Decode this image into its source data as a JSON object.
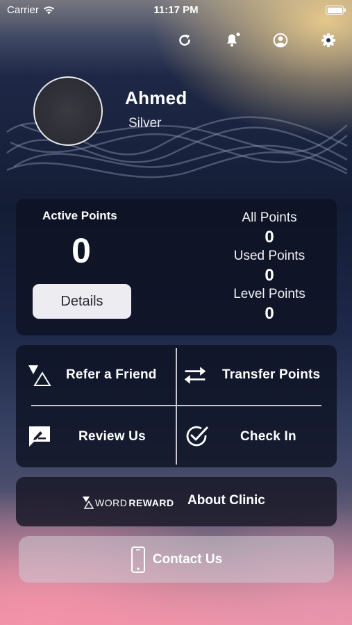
{
  "status_bar": {
    "carrier": "Carrier",
    "time": "11:17 PM"
  },
  "header_icons": [
    "refresh-icon",
    "bell-icon",
    "profile-icon",
    "gear-icon"
  ],
  "profile": {
    "name": "Ahmed",
    "level": "Silver"
  },
  "points": {
    "active_label": "Active Points",
    "active_value": "0",
    "details_label": "Details",
    "stats": [
      {
        "label": "All Points",
        "value": "0"
      },
      {
        "label": "Used Points",
        "value": "0"
      },
      {
        "label": "Level Points",
        "value": "0"
      }
    ]
  },
  "actions": [
    {
      "label": "Refer a Friend",
      "icon": "referral-icon"
    },
    {
      "label": "Transfer Points",
      "icon": "transfer-arrows-icon"
    },
    {
      "label": "Review Us",
      "icon": "review-icon"
    },
    {
      "label": "Check In",
      "icon": "check-circle-icon"
    }
  ],
  "clinic": {
    "brand_word": "WORD",
    "brand_reward": "REWARD",
    "label": "About Clinic"
  },
  "contact": {
    "label": "Contact Us",
    "icon": "phone-icon"
  },
  "colors": {
    "card_bg": "#0e1222",
    "details_button_bg": "#ececf1",
    "top_glow": "#eccd8c",
    "bottom_glow": "#f492a8"
  }
}
